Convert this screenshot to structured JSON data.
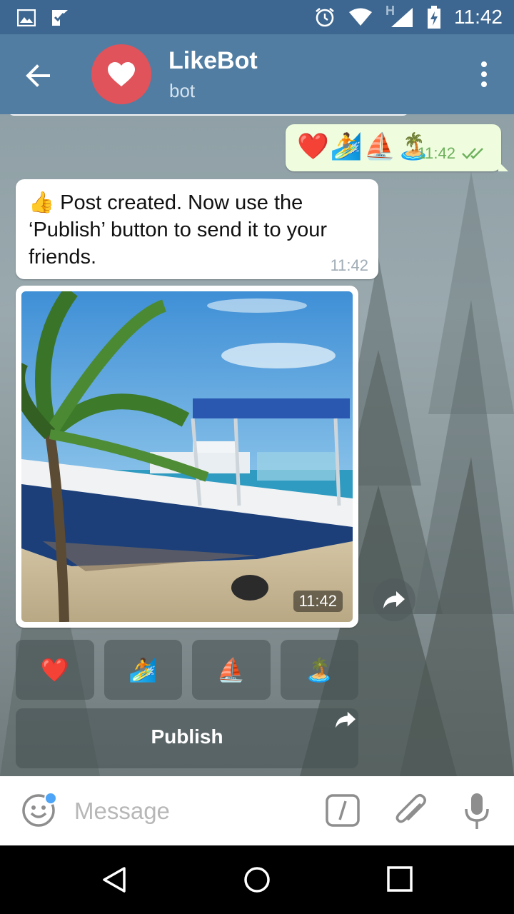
{
  "status_bar": {
    "time": "11:42",
    "network_label": "H",
    "icons": [
      "image-icon",
      "check-flag-icon",
      "alarm-icon",
      "wifi-icon",
      "signal-icon",
      "battery-charging-icon"
    ]
  },
  "header": {
    "title": "LikeBot",
    "subtitle": "bot",
    "avatar_icon": "heart-icon",
    "colors": {
      "bar": "#517da2",
      "status": "#3d6790",
      "avatar": "#e0535a"
    }
  },
  "messages": {
    "outgoing": {
      "emojis": [
        "❤️",
        "🏄",
        "⛵",
        "🏝️"
      ],
      "time": "11:42",
      "status": "read"
    },
    "incoming_text": {
      "emoji": "👍",
      "text": "Post created. Now use the ‘Publish’ button to send it to your friends.",
      "time": "11:42"
    },
    "photo": {
      "time": "11:42",
      "subject": "boat on a tropical beach under a palm tree"
    }
  },
  "inline_keyboard": {
    "row1": [
      "❤️",
      "🏄",
      "⛵",
      "🏝️"
    ],
    "publish_label": "Publish"
  },
  "input_bar": {
    "placeholder": "Message",
    "icons": [
      "emoji-icon",
      "bot-command-icon",
      "attach-icon",
      "mic-icon"
    ]
  },
  "nav_bar": {
    "icons": [
      "back-triangle-icon",
      "home-circle-icon",
      "recents-square-icon"
    ]
  }
}
